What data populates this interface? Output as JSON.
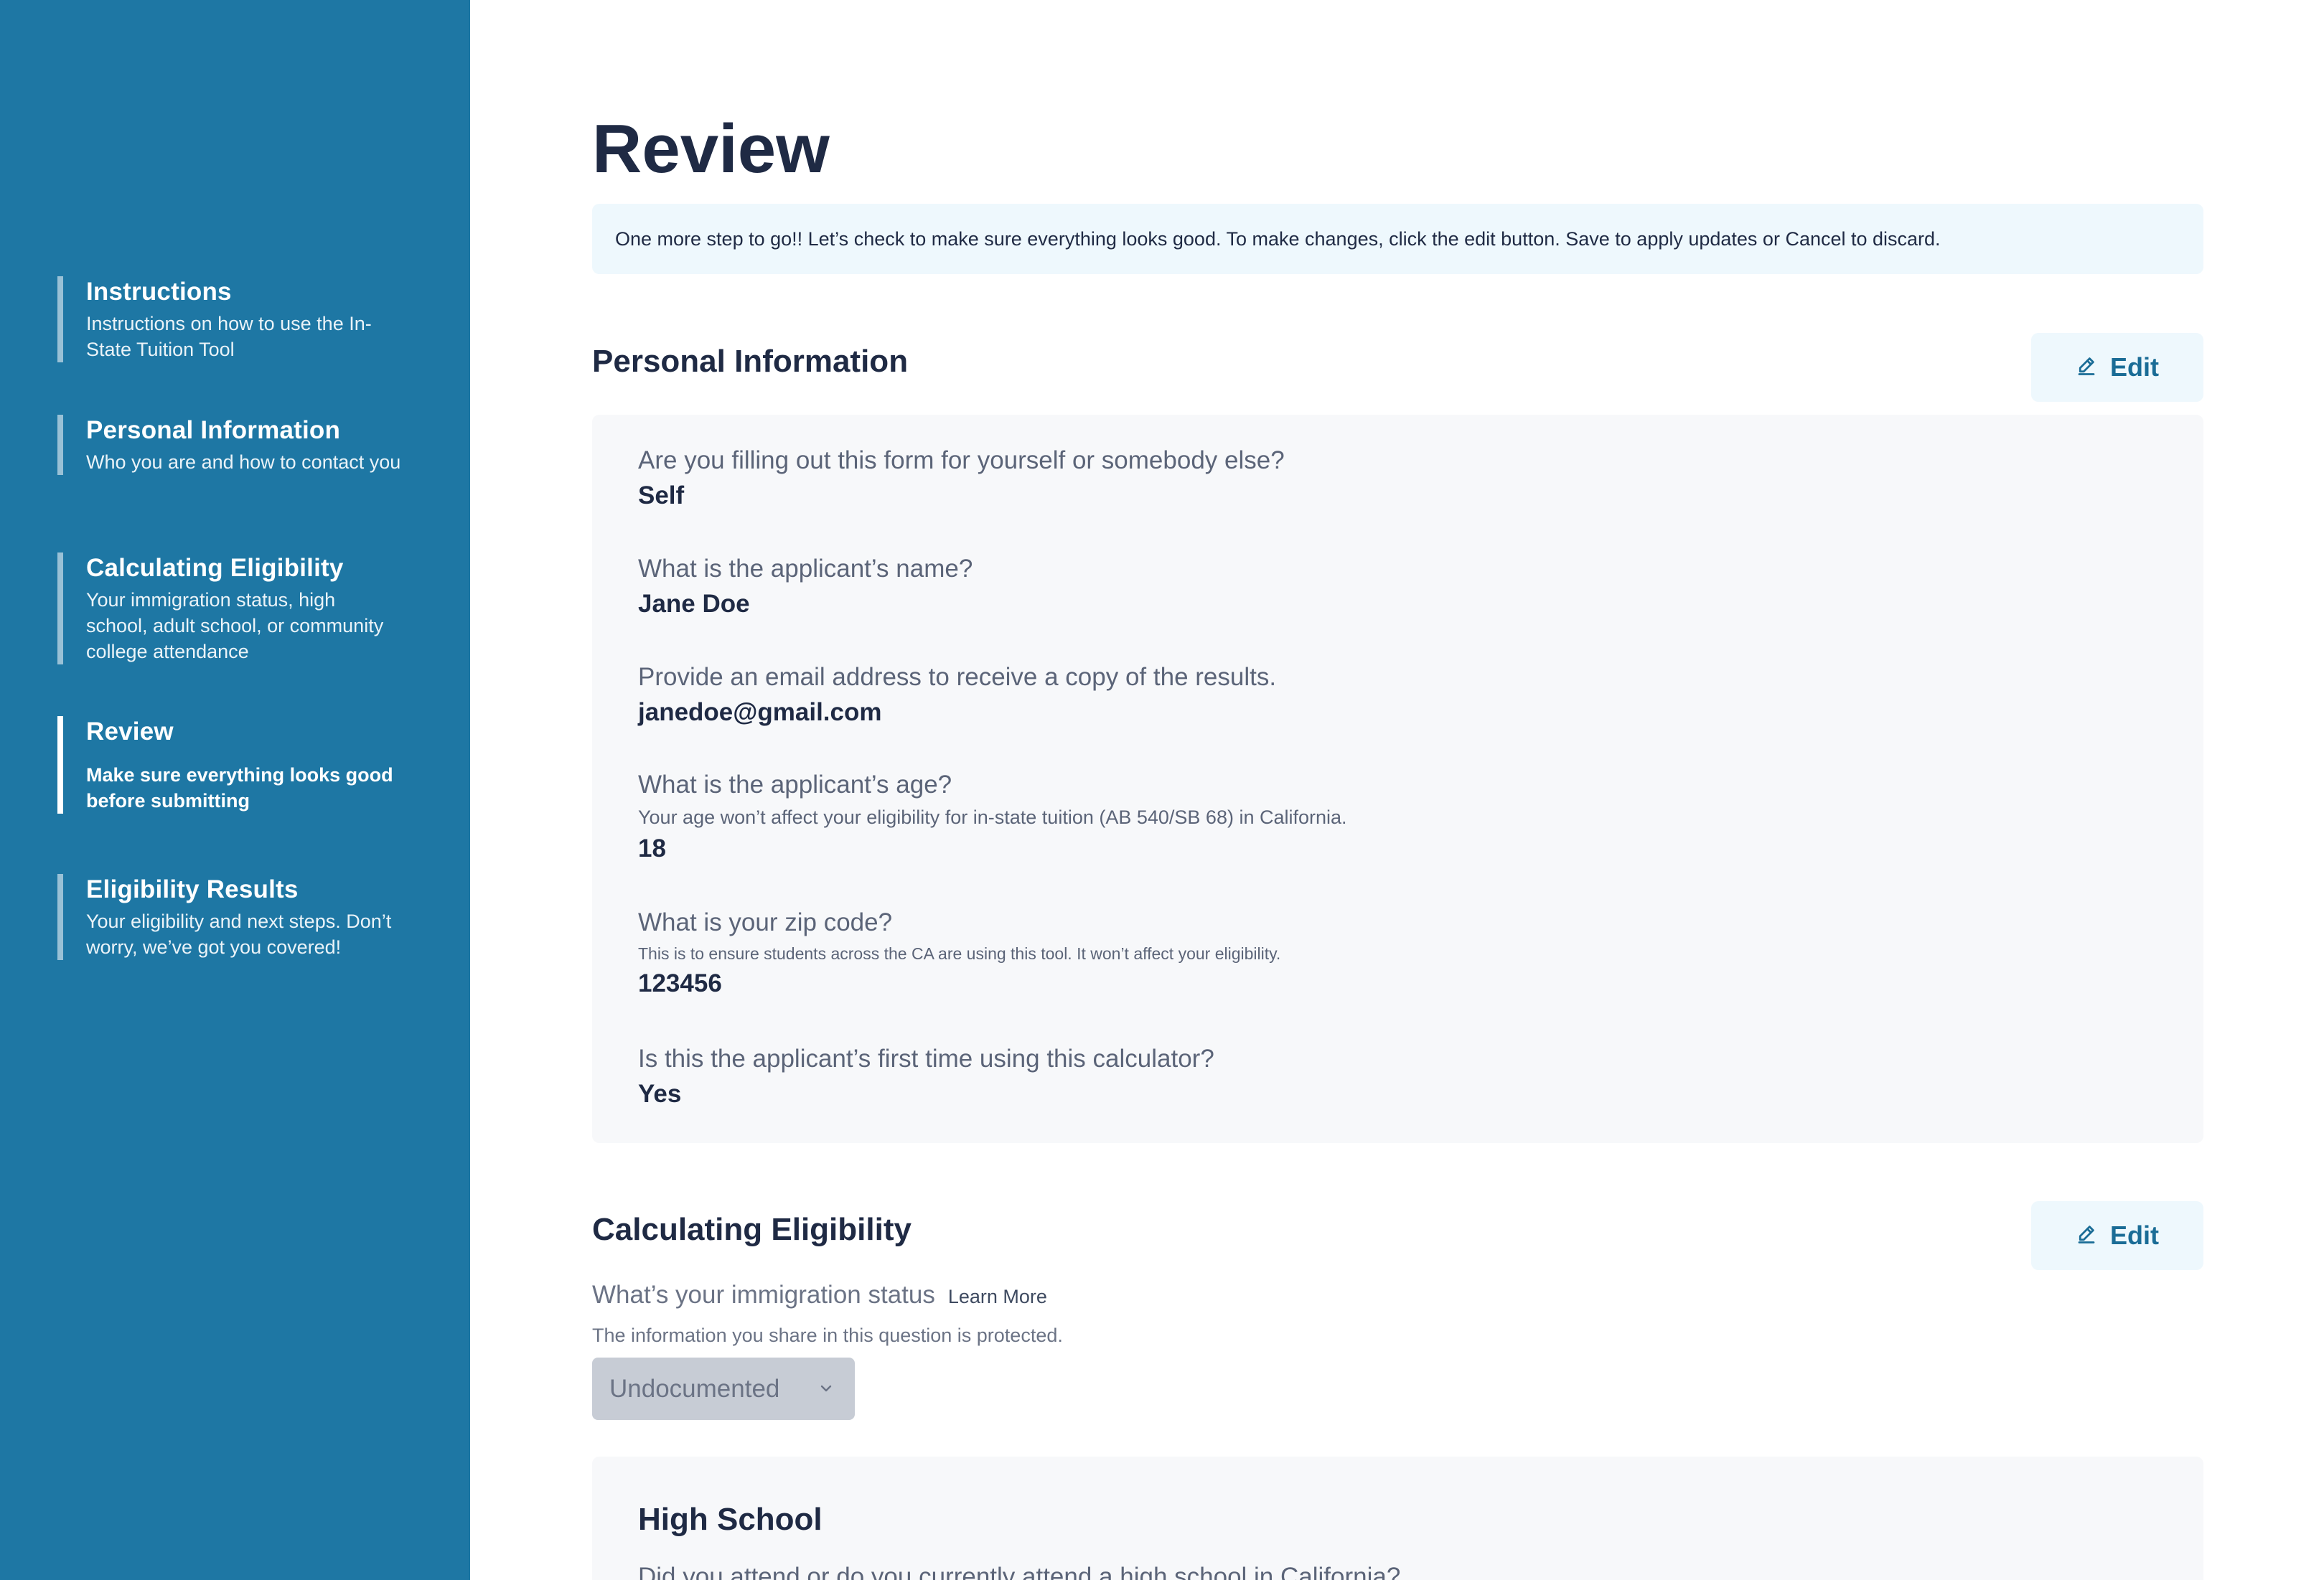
{
  "sidebar": {
    "steps": [
      {
        "title": "Instructions",
        "desc": "Instructions on how to use the In-State Tuition Tool"
      },
      {
        "title": "Personal Information",
        "desc": "Who you are and how to contact you"
      },
      {
        "title": "Calculating Eligibility",
        "desc": "Your immigration status, high school, adult school, or community college attendance"
      },
      {
        "title": "Review",
        "desc": "Make sure everything looks good before submitting"
      },
      {
        "title": "Eligibility Results",
        "desc": "Your eligibility and next steps. Don’t worry, we’ve got you covered!"
      }
    ],
    "active_step": "Review"
  },
  "main": {
    "title": "Review",
    "banner": "One more step to go!! Let’s check to make sure everything looks good. To make changes, click the edit button. Save to apply updates or Cancel to discard.",
    "personal": {
      "title": "Personal Information",
      "edit_label": "Edit",
      "items": [
        {
          "q": "Are you filling out this form for yourself or somebody else?",
          "hint": "",
          "a": "Self"
        },
        {
          "q": "What is the applicant’s name?",
          "hint": "",
          "a": "Jane Doe"
        },
        {
          "q": "Provide an email address to receive a copy of the results.",
          "hint": "",
          "a": "janedoe@gmail.com"
        },
        {
          "q": "What is the applicant’s age?",
          "hint": "Your age won’t affect your eligibility for in-state tuition (AB 540/SB 68) in California.",
          "a": "18"
        },
        {
          "q": "What is your zip code?",
          "hint": "This is to ensure students across the CA are using this tool. It won’t affect your eligibility.",
          "a": "123456"
        },
        {
          "q": "Is this the applicant’s first time using this calculator?",
          "hint": "",
          "a": "Yes"
        }
      ]
    },
    "eligibility": {
      "title": "Calculating Eligibility",
      "edit_label": "Edit",
      "immigration_question": "What’s your immigration status",
      "learn_more": "Learn More",
      "immigration_hint": "The information you share in this question is protected.",
      "immigration_value": "Undocumented",
      "high_school": {
        "title": "High School",
        "question": "Did you attend or do you currently attend a high school in California?"
      }
    }
  },
  "colors": {
    "sidebar_bg": "#1e77a4",
    "accent": "#1a6c96",
    "banner_bg": "#eef8fd",
    "panel_bg": "#f7f8fa"
  },
  "icons": {
    "edit": "pencil-icon",
    "dropdown": "chevron-down-icon"
  }
}
